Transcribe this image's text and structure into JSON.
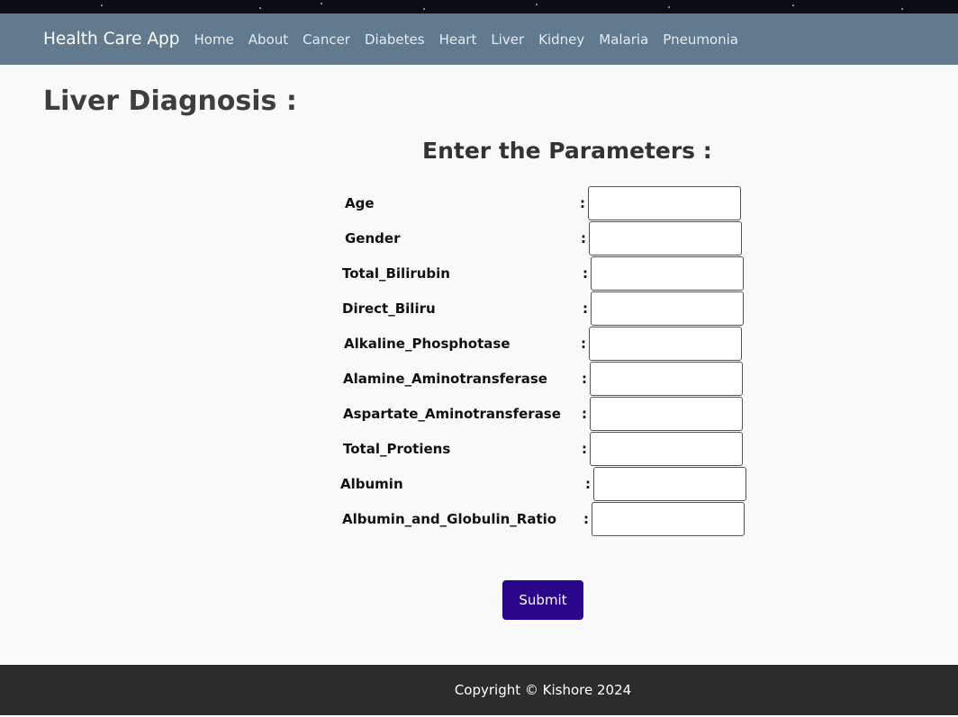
{
  "navbar": {
    "brand": "Health Care App",
    "links": [
      "Home",
      "About",
      "Cancer",
      "Diabetes",
      "Heart",
      "Liver",
      "Kidney",
      "Malaria",
      "Pneumonia"
    ]
  },
  "page": {
    "title": "Liver Diagnosis :"
  },
  "form": {
    "title": "Enter the Parameters :",
    "colon": ":",
    "fields": [
      {
        "label": "Age",
        "value": ""
      },
      {
        "label": "Gender",
        "value": ""
      },
      {
        "label": "Total_Bilirubin",
        "value": ""
      },
      {
        "label": "Direct_Biliru",
        "value": ""
      },
      {
        "label": "Alkaline_Phosphotase",
        "value": ""
      },
      {
        "label": "Alamine_Aminotransferase",
        "value": ""
      },
      {
        "label": "Aspartate_Aminotransferase",
        "value": ""
      },
      {
        "label": "Total_Protiens",
        "value": ""
      },
      {
        "label": "Albumin",
        "value": ""
      },
      {
        "label": "Albumin_and_Globulin_Ratio",
        "value": ""
      }
    ],
    "submit_label": "Submit"
  },
  "footer": {
    "text": "Copyright © Kishore 2024"
  },
  "colors": {
    "navbar_bg": "#627a8e",
    "submit_bg": "#2a078a",
    "footer_bg": "#2c2c2c",
    "page_bg": "#f9f9f9"
  }
}
